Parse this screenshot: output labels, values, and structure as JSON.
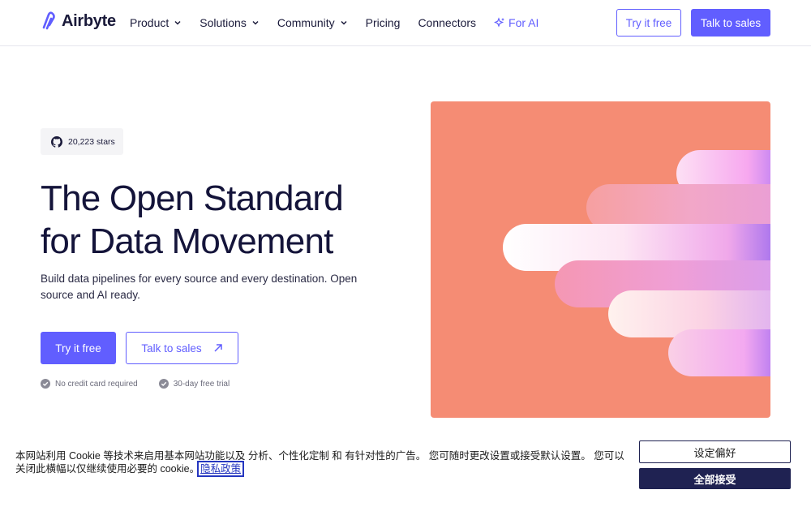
{
  "nav": {
    "brand": "Airbyte",
    "items": [
      {
        "label": "Product",
        "has_menu": true
      },
      {
        "label": "Solutions",
        "has_menu": true
      },
      {
        "label": "Community",
        "has_menu": true
      },
      {
        "label": "Pricing",
        "has_menu": false
      },
      {
        "label": "Connectors",
        "has_menu": false
      }
    ],
    "ai_label": "For AI",
    "try_label": "Try it free",
    "sales_label": "Talk to sales"
  },
  "hero": {
    "stars": "20,223 stars",
    "headline_line1": "The Open Standard",
    "headline_line2": "for Data Movement",
    "subtitle": "Build data pipelines for every source and every destination. Open source and AI ready.",
    "try_label": "Try it free",
    "sales_label": "Talk to sales",
    "check1": "No credit card required",
    "check2": "30-day free trial"
  },
  "cookie": {
    "text": "本网站利用 Cookie 等技术来启用基本网站功能以及 分析、个性化定制 和 有针对性的广告。 您可随时更改设置或接受默认设置。 您可以关闭此横幅以仅继续使用必要的 cookie。",
    "link": "隐私政策",
    "pref_label": "设定偏好",
    "accept_label": "全部接受"
  },
  "colors": {
    "accent": "#615eff",
    "art_bg": "#f58c74",
    "cookie_dark": "#1f2252"
  }
}
